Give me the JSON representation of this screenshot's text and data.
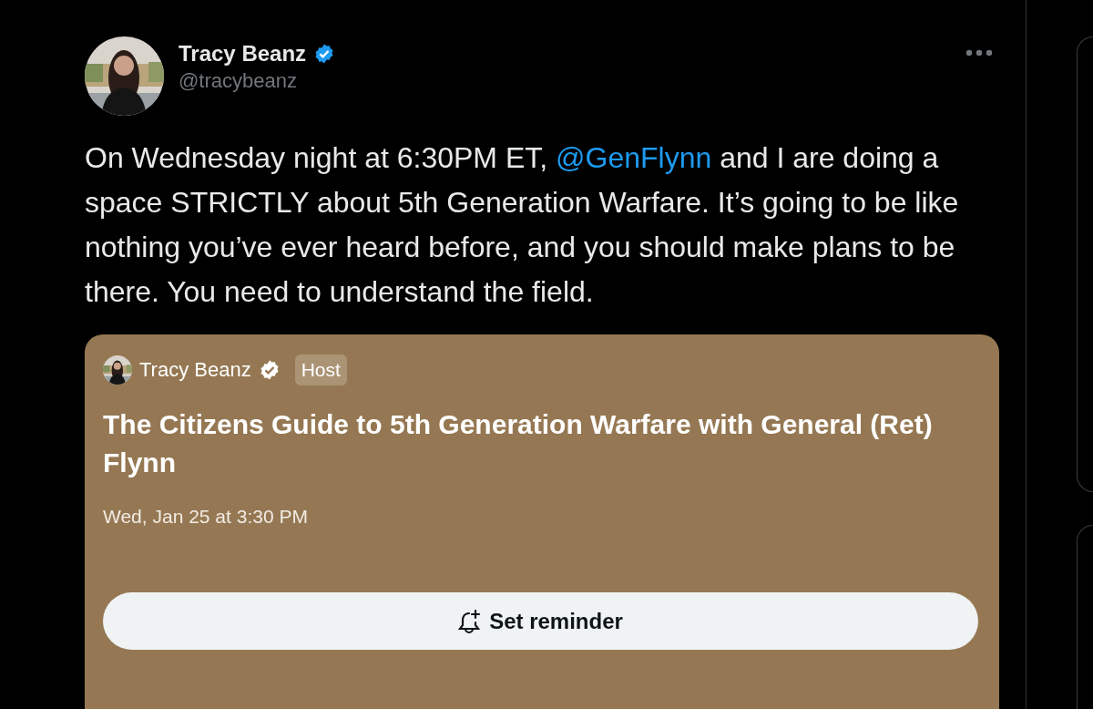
{
  "tweet": {
    "author": {
      "name": "Tracy Beanz",
      "verified": true,
      "handle": "@tracybeanz"
    },
    "text": [
      {
        "kind": "plain",
        "text": "On Wednesday night at 6:30PM ET, "
      },
      {
        "kind": "mention",
        "text": "@GenFlynn"
      },
      {
        "kind": "plain",
        "text": " and I are doing a space STRICTLY about 5th Generation Warfare. It’s going to be like nothing you’ve ever heard before, and you should make plans to be there. You need to understand the field."
      }
    ],
    "space_card": {
      "host_name": "Tracy Beanz",
      "verified": true,
      "role_badge": "Host",
      "title": "The Citizens Guide to 5th Generation Warfare with General (Ret) Flynn",
      "date": "Wed, Jan 25 at 3:30 PM",
      "button": "Set reminder"
    }
  }
}
